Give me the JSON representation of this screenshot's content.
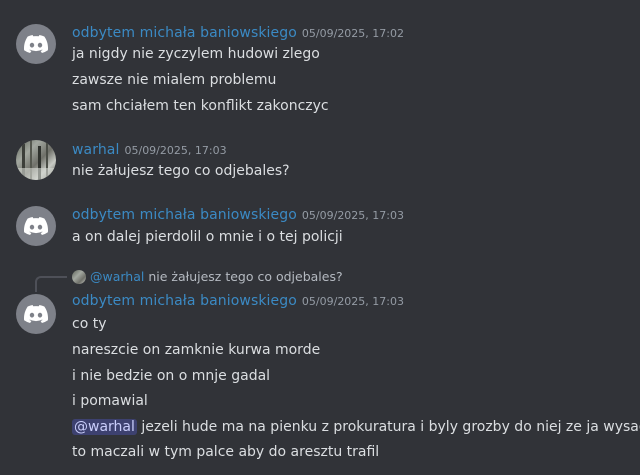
{
  "messages": [
    {
      "author": "odbytem michała baniowskiego",
      "time": "05/09/2025, 17:02",
      "avatar_icon": "discord-logo-icon",
      "lines": [
        "ja nigdy nie zyczylem hudowi zlego",
        "zawsze nie mialem problemu",
        "sam chciałem ten konflikt zakonczyc"
      ]
    },
    {
      "author": "warhal",
      "time": "05/09/2025, 17:03",
      "avatar_icon": "user-photo-avatar",
      "lines": [
        "nie żałujesz tego co odjebales?"
      ]
    },
    {
      "author": "odbytem michała baniowskiego",
      "time": "05/09/2025, 17:03",
      "avatar_icon": "discord-logo-icon",
      "lines": [
        "a on dalej pierdolil o mnie i o tej policji"
      ]
    },
    {
      "reply": {
        "mention": "@warhal",
        "text": "nie żałujesz tego co odjebales?"
      },
      "author": "odbytem michała baniowskiego",
      "time": "05/09/2025, 17:03",
      "avatar_icon": "discord-logo-icon",
      "lines": [
        "co ty",
        "nareszcie on zamknie kurwa morde",
        "i nie bedzie on o mnje gadal",
        "i pomawial"
      ],
      "mention_line": {
        "mention": "@warhal",
        "text": " jezeli hude ma na pienku z prokuratura i byly grozby do niej ze ja wysadzi"
      },
      "last_line": "to maczali w tym palce aby do aresztu trafil"
    }
  ],
  "colors": {
    "background": "#313338",
    "username": "#3b8ac4",
    "timestamp": "#949ba4",
    "text": "#dbdee1",
    "mention_bg": "#5865f24d"
  }
}
